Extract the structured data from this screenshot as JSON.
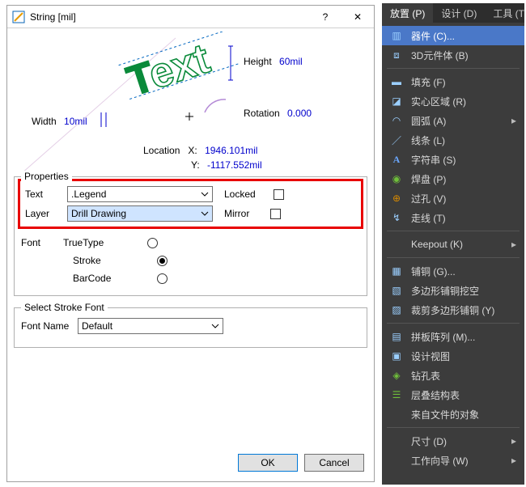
{
  "dialog": {
    "title": "String  [mil]",
    "preview": {
      "height_label": "Height",
      "height_value": "60mil",
      "width_label": "Width",
      "width_value": "10mil",
      "rotation_label": "Rotation",
      "rotation_value": "0.000",
      "location_label": "Location",
      "x_label": "X:",
      "x_value": "1946.101mil",
      "y_label": "Y:",
      "y_value": "-1117.552mil"
    },
    "properties": {
      "legend": "Properties",
      "text_label": "Text",
      "text_value": ".Legend",
      "layer_label": "Layer",
      "layer_value": "Drill Drawing",
      "locked_label": "Locked",
      "mirror_label": "Mirror",
      "font_label": "Font",
      "font_options": {
        "truetype": "TrueType",
        "stroke": "Stroke",
        "barcode": "BarCode"
      }
    },
    "stroke_font": {
      "legend": "Select Stroke Font",
      "fontname_label": "Font Name",
      "fontname_value": "Default"
    },
    "buttons": {
      "ok": "OK",
      "cancel": "Cancel"
    }
  },
  "menu": {
    "tabs": {
      "place": "放置 (P)",
      "design": "设计 (D)",
      "tools": "工具 (T)"
    },
    "items": [
      {
        "icon": "chip-icon",
        "label": "器件 (C)...",
        "highlight": true
      },
      {
        "icon": "cube-icon",
        "label": "3D元件体 (B)"
      },
      {
        "sep": true
      },
      {
        "icon": "fill-icon",
        "label": "填充 (F)"
      },
      {
        "icon": "region-icon",
        "label": "实心区域 (R)"
      },
      {
        "icon": "arc-icon",
        "label": "圆弧 (A)",
        "submenu": true
      },
      {
        "icon": "line-icon",
        "label": "线条 (L)"
      },
      {
        "icon": "string-icon",
        "label": "字符串 (S)"
      },
      {
        "icon": "pad-icon",
        "label": "焊盘 (P)"
      },
      {
        "icon": "via-icon",
        "label": "过孔 (V)"
      },
      {
        "icon": "route-icon",
        "label": "走线 (T)"
      },
      {
        "sep": true
      },
      {
        "icon": "",
        "label": "Keepout (K)",
        "submenu": true
      },
      {
        "sep": true
      },
      {
        "icon": "polygon-icon",
        "label": "铺铜 (G)..."
      },
      {
        "icon": "cutout-icon",
        "label": "多边形铺铜挖空"
      },
      {
        "icon": "slice-icon",
        "label": "裁剪多边形铺铜 (Y)"
      },
      {
        "sep": true
      },
      {
        "icon": "embed-icon",
        "label": "拼板阵列 (M)..."
      },
      {
        "icon": "view-icon",
        "label": "设计视图"
      },
      {
        "icon": "drill-icon",
        "label": "钻孔表"
      },
      {
        "icon": "layer-icon",
        "label": "层叠结构表"
      },
      {
        "icon": "",
        "label": "来自文件的对象"
      },
      {
        "sep": true
      },
      {
        "icon": "",
        "label": "尺寸 (D)",
        "submenu": true
      },
      {
        "icon": "",
        "label": "工作向导 (W)",
        "submenu": true
      }
    ]
  }
}
